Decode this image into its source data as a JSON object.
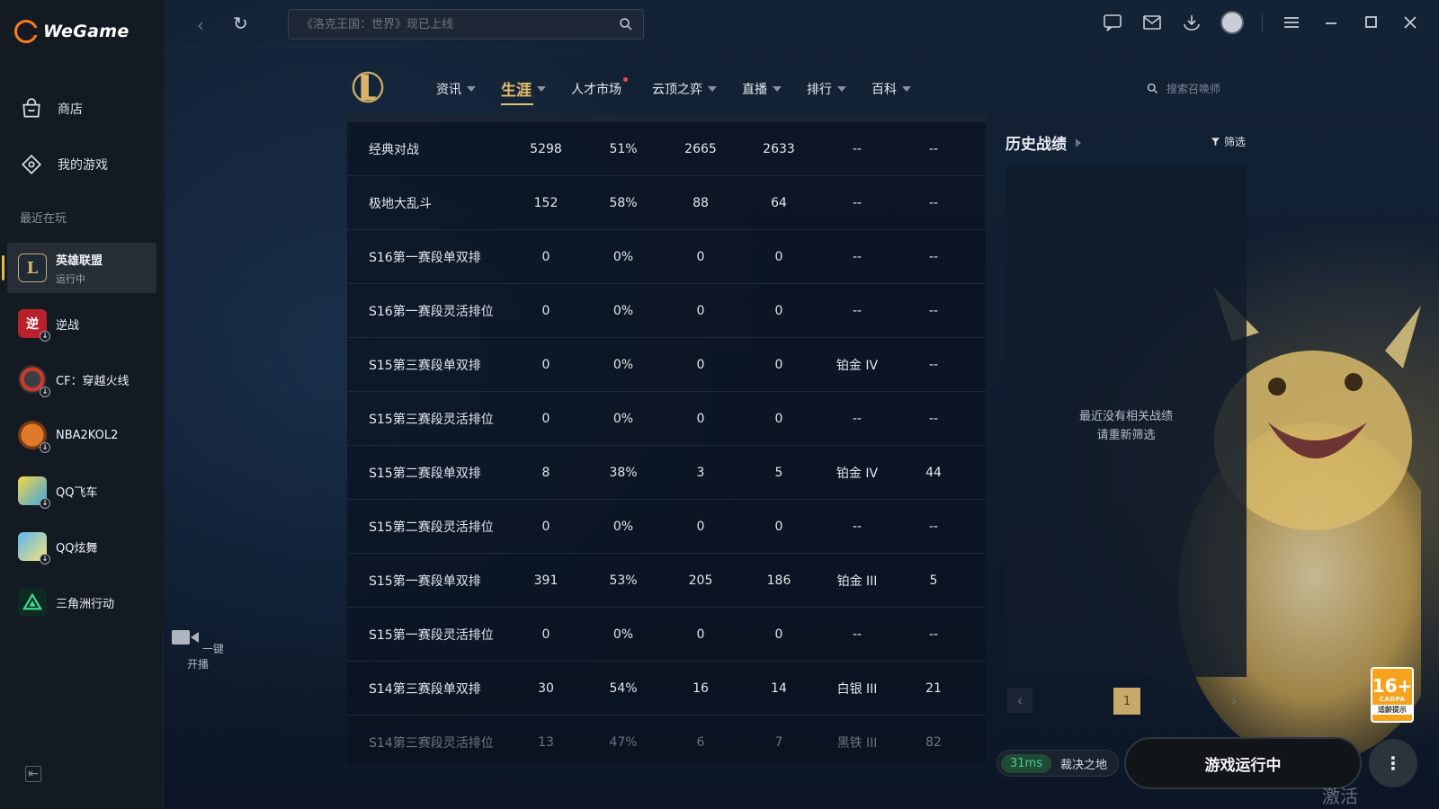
{
  "app": {
    "name": "WeGame"
  },
  "sidebar": {
    "nav": [
      {
        "label": "商店",
        "icon": "shop-icon"
      },
      {
        "label": "我的游戏",
        "icon": "my-games-icon"
      }
    ],
    "recent_label": "最近在玩",
    "games": [
      {
        "name": "英雄联盟",
        "status": "运行中",
        "icon": "lol-icon",
        "active": true
      },
      {
        "name": "逆战",
        "icon": "nizhan-icon",
        "download": true
      },
      {
        "name": "CF：穿越火线",
        "icon": "cf-icon",
        "download": true
      },
      {
        "name": "NBA2KOL2",
        "icon": "basketball-icon",
        "download": true
      },
      {
        "name": "QQ飞车",
        "icon": "qq-speed-icon",
        "download": true
      },
      {
        "name": "QQ炫舞",
        "icon": "qq-dance-icon",
        "download": true
      },
      {
        "name": "三角洲行动",
        "icon": "delta-force-icon"
      }
    ]
  },
  "topbar": {
    "search_placeholder": "《洛克王国：世界》现已上线"
  },
  "lol_nav": {
    "tabs": [
      {
        "label": "资讯"
      },
      {
        "label": "生涯"
      },
      {
        "label": "人才市场"
      },
      {
        "label": "云顶之弈"
      },
      {
        "label": "直播"
      },
      {
        "label": "排行"
      },
      {
        "label": "百科"
      }
    ],
    "summoner_search_placeholder": "搜索召唤师"
  },
  "stats_table": {
    "rows": [
      [
        "经典对战",
        "5298",
        "51%",
        "2665",
        "2633",
        "--",
        "--"
      ],
      [
        "极地大乱斗",
        "152",
        "58%",
        "88",
        "64",
        "--",
        "--"
      ],
      [
        "S16第一赛段单双排",
        "0",
        "0%",
        "0",
        "0",
        "--",
        "--"
      ],
      [
        "S16第一赛段灵活排位",
        "0",
        "0%",
        "0",
        "0",
        "--",
        "--"
      ],
      [
        "S15第三赛段单双排",
        "0",
        "0%",
        "0",
        "0",
        "铂金 IV",
        "--"
      ],
      [
        "S15第三赛段灵活排位",
        "0",
        "0%",
        "0",
        "0",
        "--",
        "--"
      ],
      [
        "S15第二赛段单双排",
        "8",
        "38%",
        "3",
        "5",
        "铂金 IV",
        "44"
      ],
      [
        "S15第二赛段灵活排位",
        "0",
        "0%",
        "0",
        "0",
        "--",
        "--"
      ],
      [
        "S15第一赛段单双排",
        "391",
        "53%",
        "205",
        "186",
        "铂金 III",
        "5"
      ],
      [
        "S15第一赛段灵活排位",
        "0",
        "0%",
        "0",
        "0",
        "--",
        "--"
      ],
      [
        "S14第三赛段单双排",
        "30",
        "54%",
        "16",
        "14",
        "白银 III",
        "21"
      ],
      [
        "S14第三赛段灵活排位",
        "13",
        "47%",
        "6",
        "7",
        "黑铁 III",
        "82"
      ]
    ]
  },
  "history": {
    "title": "历史战绩",
    "filter_label": "筛选",
    "empty_line1": "最近没有相关战绩",
    "empty_line2": "请重新筛选",
    "page": "1"
  },
  "stream": {
    "label": "一键开播"
  },
  "bottom": {
    "ping": "31ms",
    "server": "裁决之地",
    "play_label": "游戏运行中",
    "age_number": "16+",
    "age_org": "CADPA",
    "age_tip": "适龄提示",
    "watermark": "激活 Windows"
  },
  "colors": {
    "accent_gold": "#e7c06a",
    "sidebar_bg": "#141a22",
    "ping_green": "#48d08a"
  }
}
